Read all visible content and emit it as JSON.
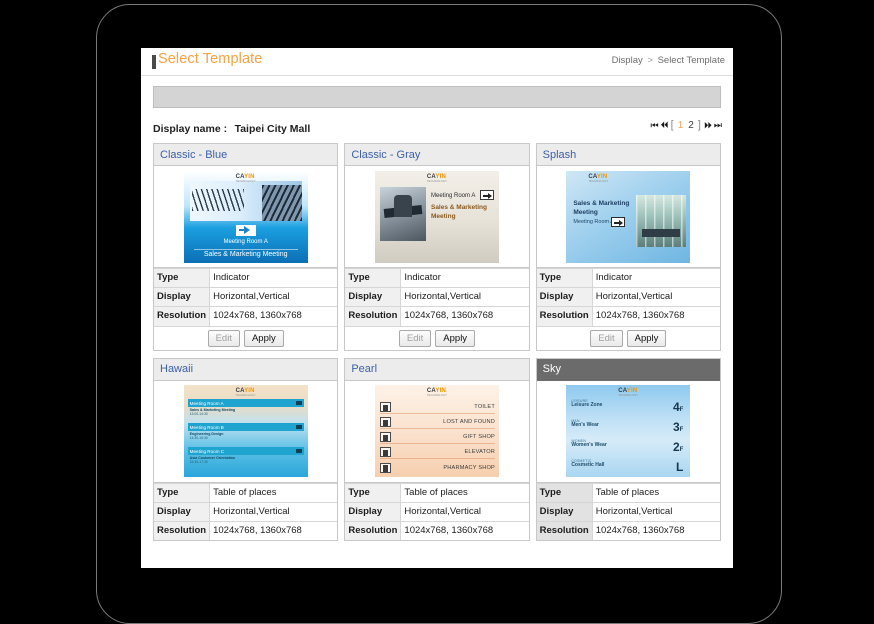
{
  "window": {
    "title": "Select Template",
    "breadcrumb": {
      "root": "Display",
      "separator": ">",
      "current": "Select Template"
    }
  },
  "display_row": {
    "label": "Display name :",
    "value": "Taipei City Mall"
  },
  "pager": {
    "first": "⏮",
    "prev": "⏴⏴",
    "open_bracket": "[",
    "close_bracket": "]",
    "pages": [
      "1",
      "2"
    ],
    "active_page": "1",
    "next": "⏵⏵",
    "last": "⏭"
  },
  "info_labels": {
    "type": "Type",
    "display": "Display",
    "resolution": "Resolution"
  },
  "actions": {
    "edit": "Edit",
    "apply": "Apply"
  },
  "colors": {
    "title_orange": "#f5a243",
    "card_title_blue": "#3c5fa8",
    "selected_header": "#6b6b6b",
    "toolbar_gray": "#d4d4d4",
    "label_cell_gray": "#f0f0f0"
  },
  "cards": [
    {
      "name": "Classic - Blue",
      "selected": false,
      "type": "Indicator",
      "display": "Horizontal,Vertical",
      "resolution": "1024x768, 1360x768",
      "has_actions": true,
      "preview": {
        "logo_main": "CAYIN",
        "logo_sub": "TECHNOLOGY",
        "room": "Meeting Room A",
        "event": "Sales & Marketing Meeting"
      }
    },
    {
      "name": "Classic - Gray",
      "selected": false,
      "type": "Indicator",
      "display": "Horizontal,Vertical",
      "resolution": "1024x768, 1360x768",
      "has_actions": true,
      "preview": {
        "logo_main": "CAYIN",
        "logo_sub": "TECHNOLOGY",
        "room": "Meeting Room A",
        "event": "Sales & Marketing Meeting"
      }
    },
    {
      "name": "Splash",
      "selected": false,
      "type": "Indicator",
      "display": "Horizontal,Vertical",
      "resolution": "1024x768, 1360x768",
      "has_actions": true,
      "preview": {
        "logo_main": "CAYIN",
        "logo_sub": "TECHNOLOGY",
        "room": "Meeting Room A",
        "event": "Sales & Marketing Meeting"
      }
    },
    {
      "name": "Hawaii",
      "selected": false,
      "type": "Table of places",
      "display": "Horizontal,Vertical",
      "resolution": "1024x768, 1360x768",
      "has_actions": false,
      "preview": {
        "logo_main": "CAYIN",
        "logo_sub": "TECHNOLOGY",
        "rows": [
          {
            "room": "Meeting Room A",
            "event": "Sales & Marketing Meeting",
            "time": "13:00-14:30"
          },
          {
            "room": "Meeting Room B",
            "event": "Engineering Design",
            "time": "14:30-15:30"
          },
          {
            "room": "Meeting Room C",
            "event": "Asia Customer Orientation",
            "time": "15:30-17:30"
          }
        ]
      }
    },
    {
      "name": "Pearl",
      "selected": false,
      "type": "Table of places",
      "display": "Horizontal,Vertical",
      "resolution": "1024x768, 1360x768",
      "has_actions": false,
      "preview": {
        "logo_main": "CAYIN",
        "logo_sub": "TECHNOLOGY",
        "rows": [
          {
            "icon": "restroom-icon",
            "label": "TOILET"
          },
          {
            "icon": "lost-and-found-icon",
            "label": "LOST AND FOUND"
          },
          {
            "icon": "gift-shop-icon",
            "label": "GIFT SHOP"
          },
          {
            "icon": "elevator-icon",
            "label": "ELEVATOR"
          },
          {
            "icon": "pharmacy-icon",
            "label": "PHARMACY SHOP"
          }
        ]
      }
    },
    {
      "name": "Sky",
      "selected": true,
      "type": "Table of places",
      "display": "Horizontal,Vertical",
      "resolution": "1024x768, 1360x768",
      "has_actions": false,
      "preview": {
        "logo_main": "CAYIN",
        "logo_sub": "TECHNOLOGY",
        "rows": [
          {
            "category": "LEISURE",
            "title": "Leisure Zone",
            "floor": "4",
            "unit": "F"
          },
          {
            "category": "MAN",
            "title": "Men's Wear",
            "floor": "3",
            "unit": "F"
          },
          {
            "category": "WOMEN",
            "title": "Women's Wear",
            "floor": "2",
            "unit": "F"
          },
          {
            "category": "COSMETIC",
            "title": "Cosmetic Hall",
            "floor": "L",
            "unit": ""
          }
        ]
      }
    }
  ]
}
